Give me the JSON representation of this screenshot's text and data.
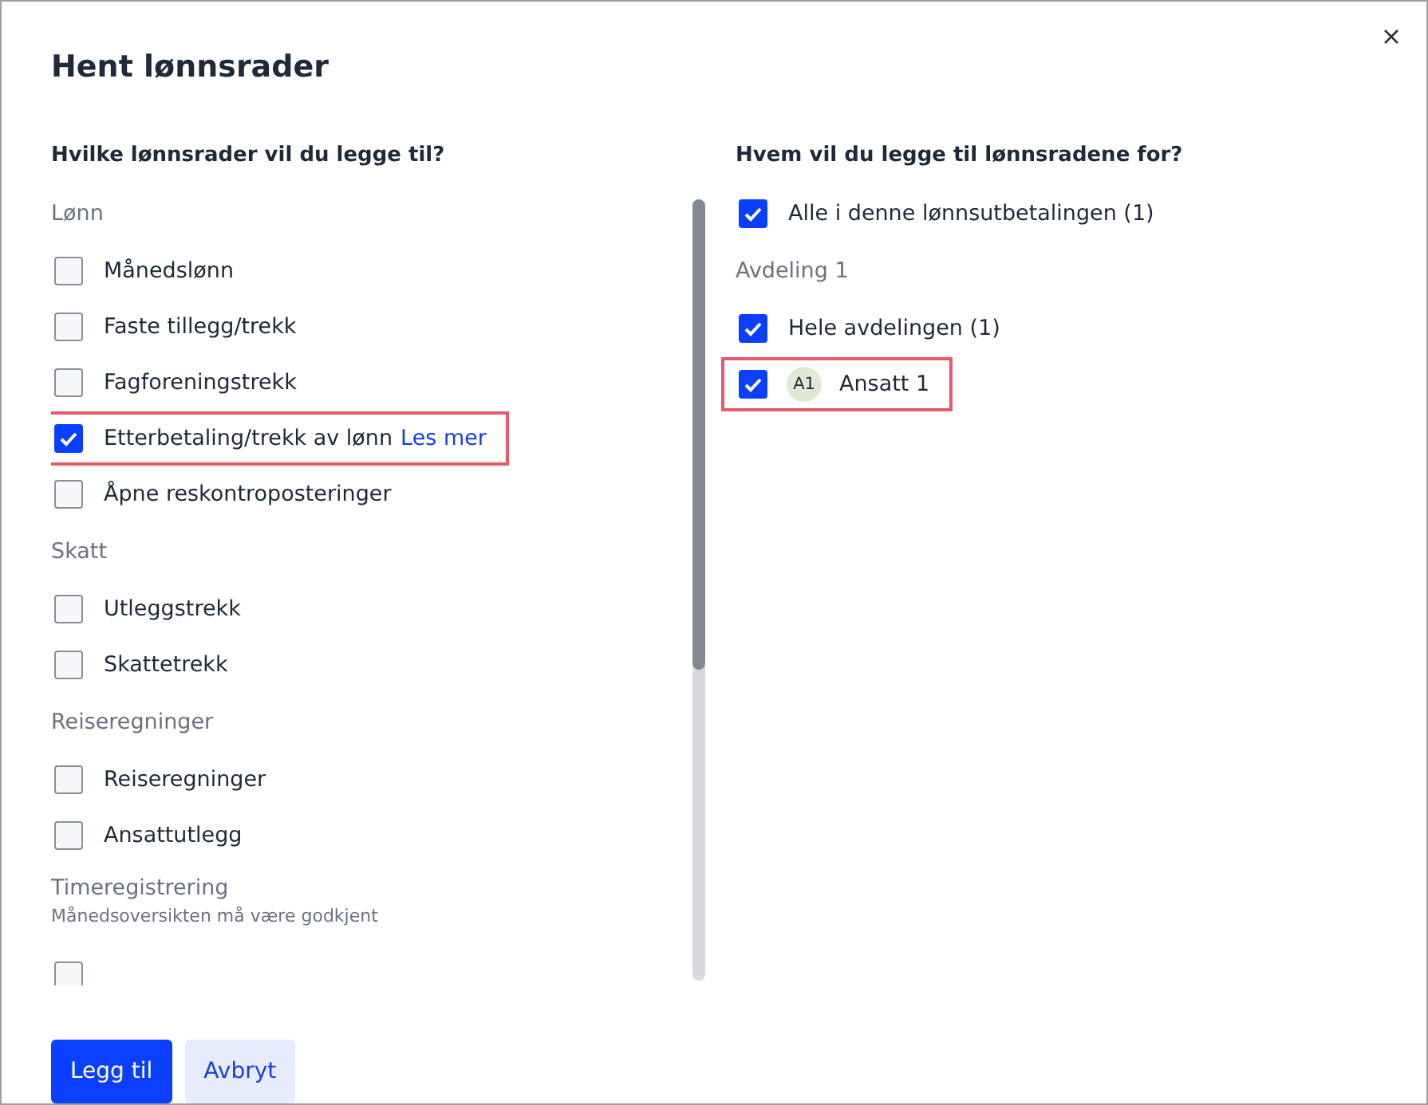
{
  "dialog": {
    "title": "Hent lønnsrader"
  },
  "left": {
    "heading": "Hvilke lønnsrader vil du legge til?",
    "groups": [
      {
        "label": "Lønn",
        "items": [
          {
            "label": "Månedslønn",
            "checked": false,
            "highlighted": false
          },
          {
            "label": "Faste tillegg/trekk",
            "checked": false,
            "highlighted": false
          },
          {
            "label": "Fagforeningstrekk",
            "checked": false,
            "highlighted": false
          },
          {
            "label": "Etterbetaling/trekk av lønn",
            "link": "Les mer",
            "checked": true,
            "highlighted": true
          },
          {
            "label": "Åpne reskontroposteringer",
            "checked": false,
            "highlighted": false
          }
        ]
      },
      {
        "label": "Skatt",
        "items": [
          {
            "label": "Utleggstrekk",
            "checked": false,
            "highlighted": false
          },
          {
            "label": "Skattetrekk",
            "checked": false,
            "highlighted": false
          }
        ]
      },
      {
        "label": "Reiseregninger",
        "items": [
          {
            "label": "Reiseregninger",
            "checked": false,
            "highlighted": false
          },
          {
            "label": "Ansattutlegg",
            "checked": false,
            "highlighted": false
          }
        ]
      },
      {
        "label": "Timeregistrering",
        "note": "Månedsoversikten må være godkjent",
        "items": [
          {
            "checked": false,
            "highlighted": false
          }
        ]
      }
    ]
  },
  "right": {
    "heading": "Hvem vil du legge til lønnsradene for?",
    "rows": [
      {
        "kind": "option",
        "label": "Alle i denne lønnsutbetalingen (1)",
        "checked": true,
        "highlighted": false
      },
      {
        "kind": "group-label",
        "label": "Avdeling 1"
      },
      {
        "kind": "option",
        "label": "Hele avdelingen (1)",
        "checked": true,
        "highlighted": false
      },
      {
        "kind": "person",
        "avatar": "A1",
        "label": "Ansatt 1",
        "checked": true,
        "highlighted": true
      }
    ]
  },
  "buttons": [
    {
      "label": "Legg til",
      "kind": "primary"
    },
    {
      "label": "Avbryt",
      "kind": "secondary"
    }
  ]
}
